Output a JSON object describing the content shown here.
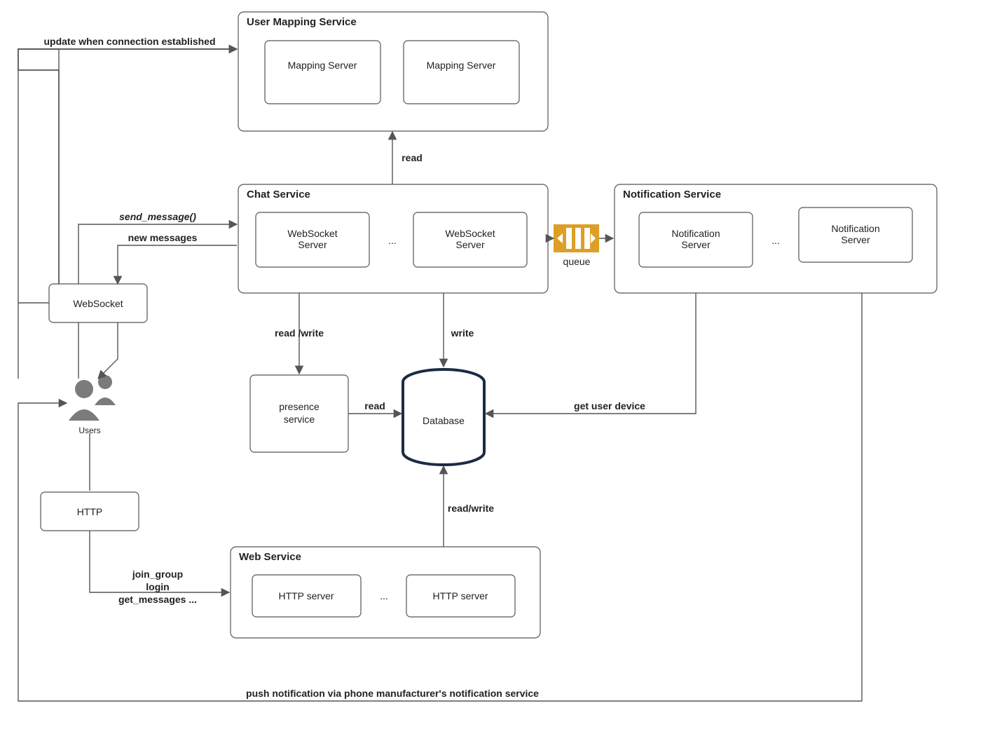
{
  "groups": {
    "user_mapping": {
      "title": "User Mapping Service",
      "items": [
        "Mapping Server",
        "Mapping Server"
      ]
    },
    "chat": {
      "title": "Chat Service",
      "items": [
        "WebSocket Server",
        "WebSocket Server"
      ],
      "sep": "..."
    },
    "notif": {
      "title": "Notification Service",
      "items": [
        "Notification Server",
        "Notification Server"
      ],
      "sep": "..."
    },
    "web": {
      "title": "Web Service",
      "items": [
        "HTTP server",
        "HTTP server"
      ],
      "sep": "..."
    }
  },
  "nodes": {
    "websocket": "WebSocket",
    "http": "HTTP",
    "users": "Users",
    "presence": "presence service",
    "database": "Database",
    "queue": "queue"
  },
  "edges": {
    "update_conn": "update when connection established",
    "send_msg": "send_message()",
    "new_msg": "new messages",
    "read": "read",
    "read_write": "read /write",
    "write": "write",
    "rw": "read/write",
    "get_device": "get user device",
    "join": "join_group",
    "login": "login",
    "getmsgs": "get_messages ...",
    "push": "push notification via phone manufacturer's notification service"
  }
}
